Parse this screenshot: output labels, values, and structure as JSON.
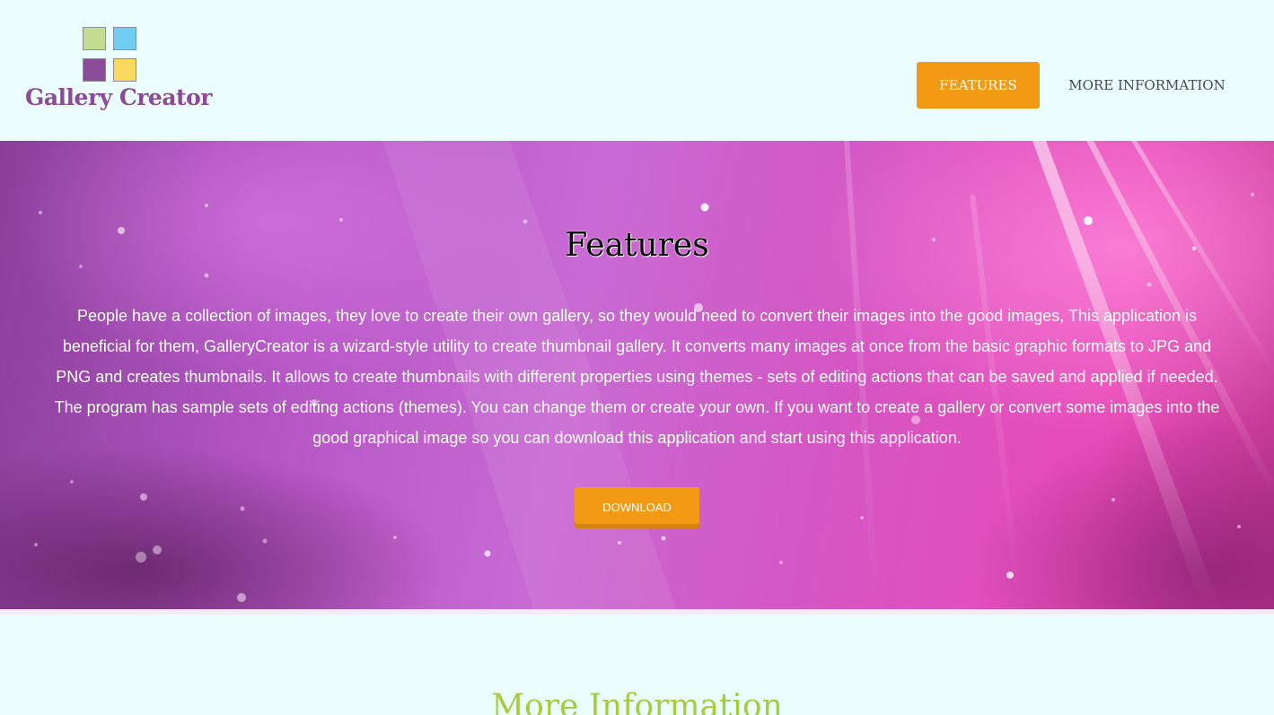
{
  "colors": {
    "accent_orange": "#f29a14",
    "logo_purple": "#8a4b98",
    "tile_green": "#c4dd8e",
    "tile_blue": "#6fcdf1",
    "tile_purple": "#8a4b98",
    "tile_yellow": "#fbd85e",
    "section_title_green": "#a9cc3c",
    "page_bg": "#ebfdfd"
  },
  "logo": {
    "text": "Gallery Creator",
    "icon": "four-square-tiles-icon"
  },
  "nav": {
    "features_label": "FEATURES",
    "more_info_label": "MORE INFORMATION"
  },
  "hero": {
    "title": "Features",
    "description": "People have a collection of images, they love to create their own gallery, so they would need to convert their images into the good images, This application is beneficial for them, GalleryCreator is a wizard-style utility to create thumbnail gallery. It converts many images at once from the basic graphic formats to JPG and PNG and creates thumbnails. It allows to create thumbnails with different properties using themes - sets of editing actions that can be saved and applied if needed. The program has sample sets of editing actions (themes). You can change them or create your own. If you want to create a gallery or convert some images into the good graphical image so you can download this application and start using this application.",
    "download_label": "DOWNLOAD"
  },
  "more_section": {
    "title": "More Information"
  }
}
